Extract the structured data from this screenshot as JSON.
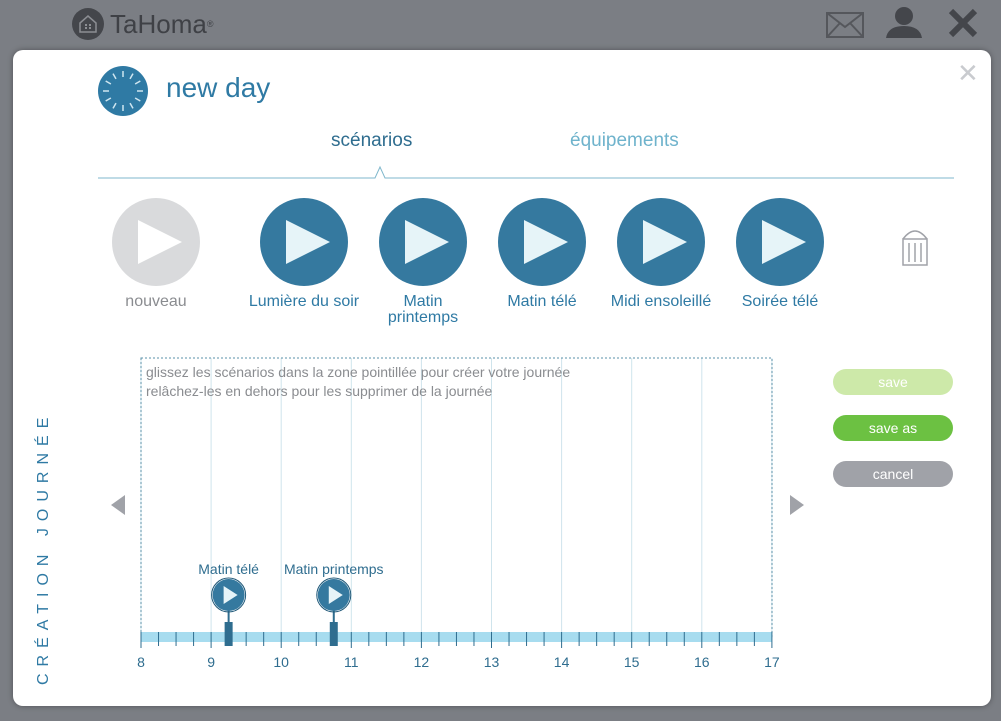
{
  "app": {
    "name": "TaHoma",
    "reg": "®"
  },
  "header_icons": [
    "mail-icon",
    "user-icon",
    "close-icon"
  ],
  "modal": {
    "title": "new day",
    "close_icon": "close-icon"
  },
  "tabs": [
    {
      "label": "scénarios",
      "active": true
    },
    {
      "label": "équipements",
      "active": false
    }
  ],
  "scenarios": [
    {
      "label": "nouveau",
      "kind": "new"
    },
    {
      "label": "Lumière du soir",
      "kind": "scenario"
    },
    {
      "label": "Matin\nprintemps",
      "kind": "scenario"
    },
    {
      "label": "Matin télé",
      "kind": "scenario"
    },
    {
      "label": "Midi ensoleillé",
      "kind": "scenario"
    },
    {
      "label": "Soirée télé",
      "kind": "scenario"
    }
  ],
  "side_label": "CRÉATION JOURNÉE",
  "timeline": {
    "help_line1": "glissez les scénarios dans la zone pointillée pour créer votre journée",
    "help_line2": "relâchez-les en dehors pour les supprimer de la journée",
    "hours": [
      "8",
      "9",
      "10",
      "11",
      "12",
      "13",
      "14",
      "15",
      "16",
      "17"
    ],
    "markers": [
      {
        "label": "Matin télé",
        "time": 9.25
      },
      {
        "label": "Matin printemps",
        "time": 10.75
      }
    ]
  },
  "actions": {
    "save": "save",
    "save_as": "save as",
    "cancel": "cancel"
  },
  "colors": {
    "accent": "#2f7aa4",
    "scenario": "#35799f",
    "new_scenario": "#d9dadc",
    "save_disabled": "#cde9a9",
    "save_as": "#6cc142",
    "cancel": "#a0a2a8",
    "track": "#a7dcef"
  }
}
